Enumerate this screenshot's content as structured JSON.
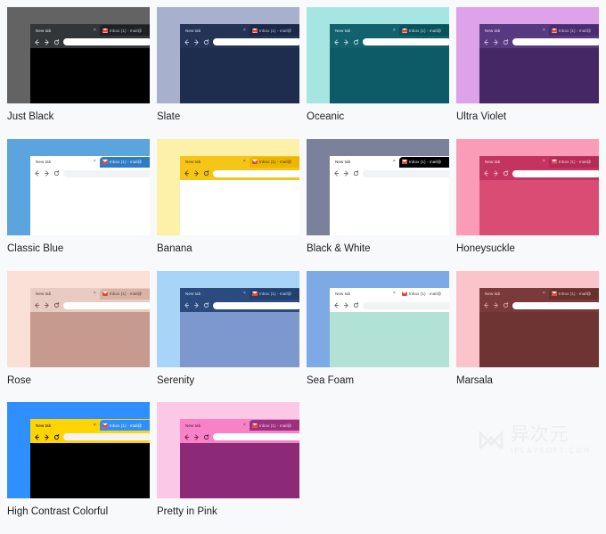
{
  "page": {
    "background": "#f8f9fa",
    "label_color": "#202124"
  },
  "browser_mock": {
    "active_tab_title": "New tab",
    "active_tab_close": "×",
    "inactive_tab_title": "Inbox (1) - mail@",
    "inactive_tab_favicon": "gmail-favicon",
    "back_icon": "back-arrow-icon",
    "forward_icon": "forward-arrow-icon",
    "reload_icon": "reload-icon",
    "urlbar_value": "",
    "urlbar_color": "#ffffff"
  },
  "watermark": {
    "logo": "n-monogram-logo",
    "cn_text": "异次元",
    "en_text": "IPLAYSOFT.COM",
    "color": "#ededed"
  },
  "themes": [
    {
      "name": "Just Black",
      "frame": "#636363",
      "window": "#202124",
      "tab_active_bg": "#323639",
      "tab_active_text": "#e8eaed",
      "tab_inactive_bg": "#202124",
      "tab_inactive_text": "#c8cacd",
      "toolbar": "#323639",
      "icon": "#d8d8d8",
      "viewport": "#000000",
      "urlbar": "#ffffff"
    },
    {
      "name": "Slate",
      "frame": "#a7b1cd",
      "window": "#1e2c4e",
      "tab_active_bg": "#243356",
      "tab_active_text": "#dde3f0",
      "tab_inactive_bg": "#1b2848",
      "tab_inactive_text": "#c3cbdf",
      "toolbar": "#243356",
      "icon": "#c6cee0",
      "viewport": "#1e2c4e",
      "urlbar": "#ffffff"
    },
    {
      "name": "Oceanic",
      "frame": "#a6e6e2",
      "window": "#0d5b66",
      "tab_active_bg": "#12626d",
      "tab_active_text": "#d9f1f2",
      "tab_inactive_bg": "#0b525c",
      "tab_inactive_text": "#c4e4e6",
      "toolbar": "#12626d",
      "icon": "#bfe3e4",
      "viewport": "#0d5b66",
      "urlbar": "#ffffff"
    },
    {
      "name": "Ultra Violet",
      "frame": "#dda2ea",
      "window": "#452766",
      "tab_active_bg": "#573980",
      "tab_active_text": "#e8dcf2",
      "tab_inactive_bg": "#4a2d70",
      "tab_inactive_text": "#d7c6e6",
      "toolbar": "#573980",
      "icon": "#d4c1e6",
      "viewport": "#452766",
      "urlbar": "#ffffff"
    },
    {
      "name": "Classic Blue",
      "frame": "#5ba4dd",
      "window": "#ffffff",
      "tab_active_bg": "#ffffff",
      "tab_active_text": "#3c4043",
      "tab_inactive_bg": "#2f7cc4",
      "tab_inactive_text": "#e8f1fa",
      "toolbar": "#ffffff",
      "icon": "#5f6368",
      "viewport": "#ffffff",
      "urlbar": "#f1f3f4"
    },
    {
      "name": "Banana",
      "frame": "#fdf0a8",
      "window": "#ffffff",
      "tab_active_bg": "#f5c518",
      "tab_active_text": "#3c2f00",
      "tab_inactive_bg": "#edb700",
      "tab_inactive_text": "#3c2f00",
      "toolbar": "#f5c518",
      "icon": "#4a3a00",
      "viewport": "#ffffff",
      "urlbar": "#ffffff"
    },
    {
      "name": "Black & White",
      "frame": "#7b819b",
      "window": "#ffffff",
      "tab_active_bg": "#ffffff",
      "tab_active_text": "#202124",
      "tab_inactive_bg": "#000000",
      "tab_inactive_text": "#f1f3f4",
      "toolbar": "#ffffff",
      "icon": "#5f6368",
      "viewport": "#ffffff",
      "urlbar": "#f1f3f4"
    },
    {
      "name": "Honeysuckle",
      "frame": "#fa9cb8",
      "window": "#d94d74",
      "tab_active_bg": "#c33560",
      "tab_active_text": "#fde3ec",
      "tab_inactive_bg": "#b32b56",
      "tab_inactive_text": "#f9d2e0",
      "toolbar": "#c33560",
      "icon": "#f6c6d6",
      "viewport": "#d94d74",
      "urlbar": "#ffffff"
    },
    {
      "name": "Rose",
      "frame": "#fae0d6",
      "window": "#c79a8f",
      "tab_active_bg": "#e8cbc2",
      "tab_active_text": "#4d3a35",
      "tab_inactive_bg": "#d9b2a6",
      "tab_inactive_text": "#4d3a35",
      "toolbar": "#e8cbc2",
      "icon": "#6b5249",
      "viewport": "#c79a8f",
      "urlbar": "#ffffff"
    },
    {
      "name": "Serenity",
      "frame": "#a8d4f7",
      "window": "#7d98cc",
      "tab_active_bg": "#2b4a7e",
      "tab_active_text": "#dce6f5",
      "tab_inactive_bg": "#23406f",
      "tab_inactive_text": "#cddbf0",
      "toolbar": "#2b4a7e",
      "icon": "#c6d5ec",
      "viewport": "#7d98cc",
      "urlbar": "#ffffff"
    },
    {
      "name": "Sea Foam",
      "frame": "#7daae4",
      "window": "#b2e2d5",
      "tab_active_bg": "#ffffff",
      "tab_active_text": "#3c4043",
      "tab_inactive_bg": "#ffffff",
      "tab_inactive_text": "#3c4043",
      "toolbar": "#ffffff",
      "icon": "#5f6368",
      "viewport": "#b2e2d5",
      "urlbar": "#f1f3f4"
    },
    {
      "name": "Marsala",
      "frame": "#fbc4cb",
      "window": "#6e3434",
      "tab_active_bg": "#7b3a3a",
      "tab_active_text": "#f0d8d8",
      "tab_inactive_bg": "#6a3030",
      "tab_inactive_text": "#e6c9c9",
      "toolbar": "#7b3a3a",
      "icon": "#d9a8a8",
      "viewport": "#6e3434",
      "urlbar": "#ffffff"
    },
    {
      "name": "High Contrast Colorful",
      "frame": "#2f8fff",
      "window": "#000000",
      "tab_active_bg": "#ffd400",
      "tab_active_text": "#000000",
      "tab_inactive_bg": "#2f8fff",
      "tab_inactive_text": "#ffffff",
      "toolbar": "#ffd400",
      "icon": "#000000",
      "viewport": "#000000",
      "urlbar": "#f1f3f4"
    },
    {
      "name": "Pretty in Pink",
      "frame": "#fbc8e8",
      "window": "#8c2a78",
      "tab_active_bg": "#f982c6",
      "tab_active_text": "#4a1138",
      "tab_inactive_bg": "#9c2f7e",
      "tab_inactive_text": "#f6d6ea",
      "toolbar": "#f982c6",
      "icon": "#5a1a44",
      "viewport": "#8c2a78",
      "urlbar": "#ffffff"
    }
  ]
}
